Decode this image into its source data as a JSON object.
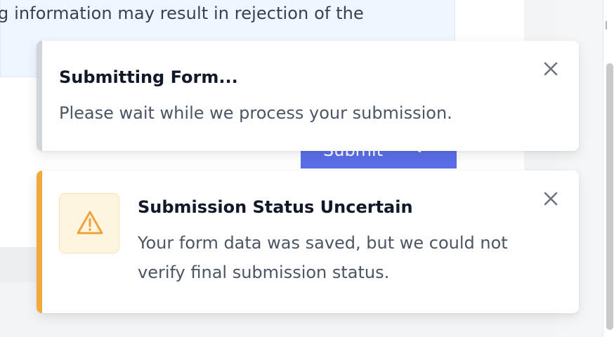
{
  "background_form": {
    "info_text": "g information may result in rejection of the",
    "submit_label": "Submit",
    "submit_chevron_icon": "chevron-down-icon"
  },
  "toasts": [
    {
      "type": "progress",
      "title": "Submitting Form...",
      "message": "Please wait while we process your submission.",
      "accent_color": "#d1d5db",
      "close_icon": "close-icon"
    },
    {
      "type": "warning",
      "title": "Submission Status Uncertain",
      "message": "Your form data was saved, but we could not verify final submission status.",
      "accent_color": "#f2a93b",
      "icon": "warning-triangle-icon",
      "close_icon": "close-icon"
    }
  ],
  "colors": {
    "button_primary": "#5b6ee8",
    "warning_accent": "#f2a93b",
    "info_banner_bg": "#eff6ff"
  }
}
